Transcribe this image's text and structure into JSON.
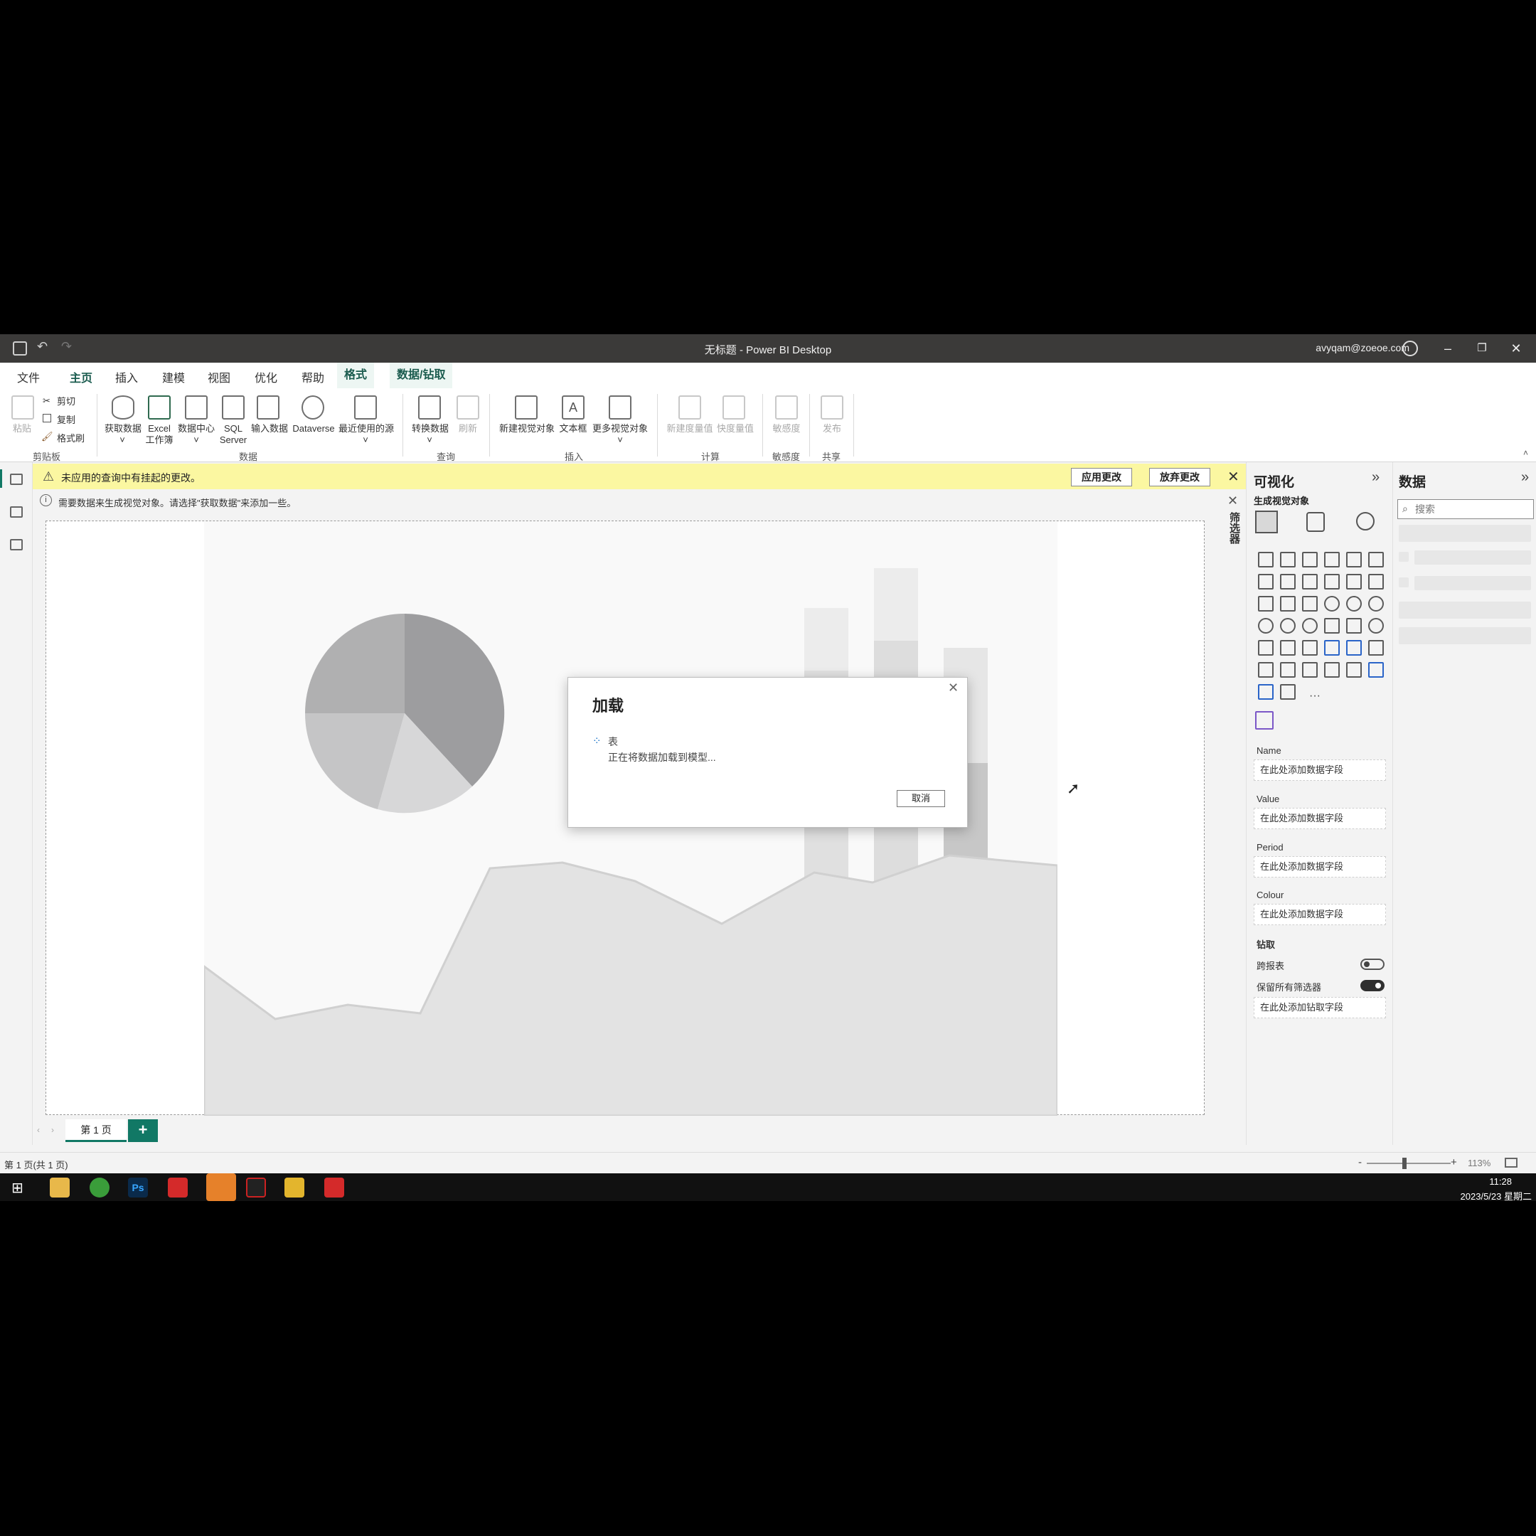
{
  "window": {
    "title": "无标题 - Power BI Desktop",
    "user": "avyqam@zoeoe.com",
    "minimize": "–",
    "restore": "❐",
    "close": "✕"
  },
  "menu": {
    "tabs": [
      {
        "label": "文件"
      },
      {
        "label": "主页"
      },
      {
        "label": "插入"
      },
      {
        "label": "建模"
      },
      {
        "label": "视图"
      },
      {
        "label": "优化"
      },
      {
        "label": "帮助"
      },
      {
        "label": "格式"
      },
      {
        "label": "数据/钻取"
      }
    ]
  },
  "ribbon": {
    "paste": "粘贴",
    "cut": "剪切",
    "copy": "复制",
    "format_painter": "格式刷",
    "clipboard_group": "剪贴板",
    "get_data": "获取数据",
    "excel_1": "Excel",
    "excel_2": "工作簿",
    "data_hub": "数据中心",
    "sql_1": "SQL",
    "sql_2": "Server",
    "enter_data": "输入数据",
    "dataverse": "Dataverse",
    "recent_sources": "最近使用的源",
    "data_group": "数据",
    "transform": "转换数据",
    "refresh": "刷新",
    "query_group": "查询",
    "new_visual": "新建视觉对象",
    "textbox": "文本框",
    "more_visuals": "更多视觉对象",
    "insert_group": "插入",
    "new_measure": "新建度量值",
    "quick_measure": "快度量值",
    "calc_group": "计算",
    "sensitivity": "敏感度",
    "sensitivity_group": "敏感度",
    "publish": "发布",
    "share_group": "共享"
  },
  "notification": {
    "message": "未应用的查询中有挂起的更改。",
    "apply": "应用更改",
    "discard": "放弃更改"
  },
  "info_bar": {
    "message": "需要数据来生成视觉对象。请选择\"获取数据\"来添加一些。"
  },
  "filters_label": "筛选器",
  "viz_pane": {
    "title": "可视化",
    "build_visual": "生成视觉对象",
    "more": "···",
    "wells": [
      {
        "label": "Name",
        "placeholder": "在此处添加数据字段"
      },
      {
        "label": "Value",
        "placeholder": "在此处添加数据字段"
      },
      {
        "label": "Period",
        "placeholder": "在此处添加数据字段"
      },
      {
        "label": "Colour",
        "placeholder": "在此处添加数据字段"
      }
    ],
    "drill_title": "钻取",
    "cross_report": "跨报表",
    "keep_filters": "保留所有筛选器",
    "drill_placeholder": "在此处添加钻取字段"
  },
  "data_pane": {
    "title": "数据",
    "search_placeholder": "搜索"
  },
  "dialog": {
    "title": "加载",
    "item": "表",
    "status": "正在将数据加载到模型...",
    "cancel": "取消"
  },
  "pages": {
    "tab1": "第 1 页",
    "add": "+"
  },
  "status": {
    "page_info": "第 1 页(共 1 页)",
    "zoom": "113%",
    "zoom_fraction": 0.45
  },
  "taskbar": {
    "time": "11:28",
    "date": "2023/5/23 星期二"
  }
}
